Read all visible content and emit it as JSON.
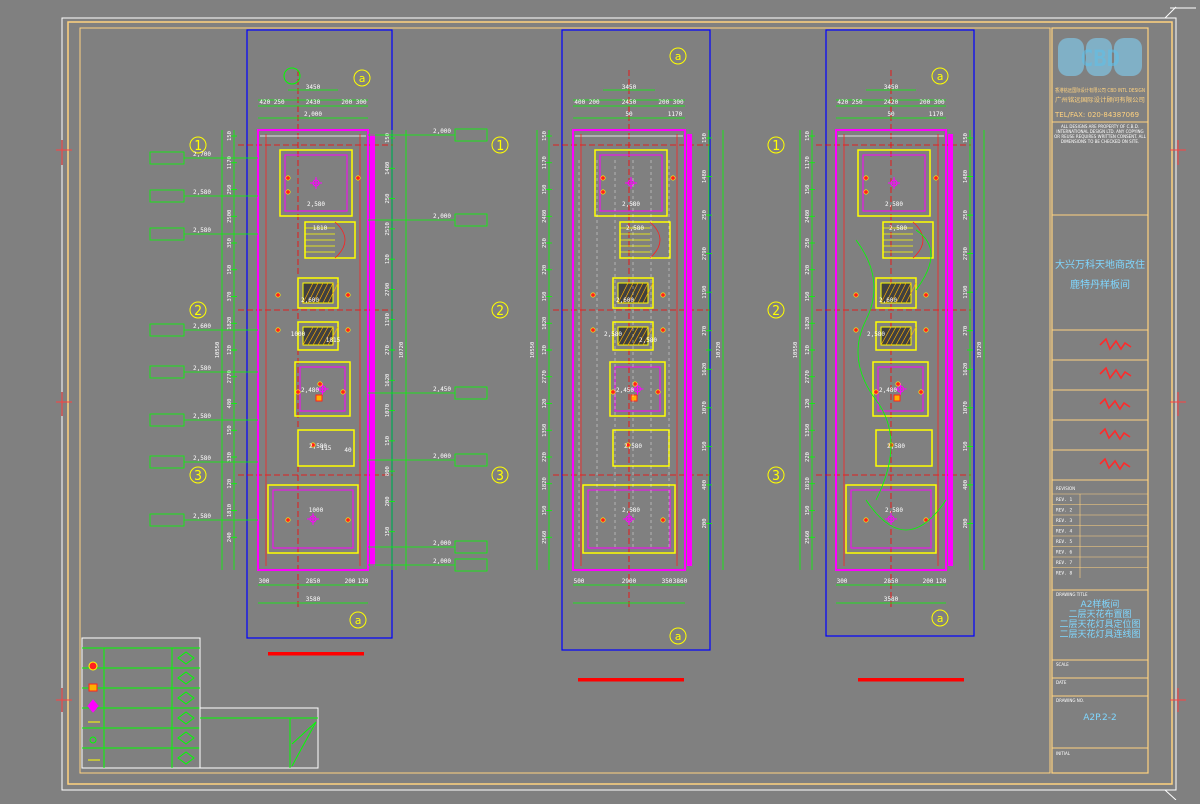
{
  "colors": {
    "background": "#808080",
    "frame": "#ffd27f",
    "wall": "#ff00ff",
    "room": "#ffff00",
    "dimension": "#00ff00",
    "text_green": "#00ff00",
    "title_blue": "#7fd7ff",
    "grid_axis": "#ff0000",
    "plan_frame": "#0000ff",
    "hatch": "#ffb000",
    "signature": "#ff2a2a"
  },
  "title_block": {
    "logo": "CBD",
    "company_line1": "香港铭远国际设计有限公司 CBD INTL DESIGN",
    "company_line2": "广州铭远国际设计顾问有限公司",
    "tel": "TEL/FAX: 020-84387069",
    "notes": "ALL DESIGNS ARE PROPERTY OF C.B.D. INTERNATIONAL DESIGN LTD. ANY COPYING OR REUSE REQUIRES WRITTEN CONSENT. ALL DIMENSIONS TO BE CHECKED ON SITE.",
    "project_line1": "大兴万科天地商改住",
    "project_line2": "鹿特丹样板间",
    "revision_header": "REVISION",
    "revisions": [
      "REV. 1",
      "REV. 2",
      "REV. 3",
      "REV. 4",
      "REV. 5",
      "REV. 6",
      "REV. 7",
      "REV. 8"
    ],
    "drawing_title_header": "DRAWING TITLE",
    "drawing_titles": [
      "A2样板间",
      "二层天花布置图",
      "二层天花灯具定位图",
      "二层天花灯具连线图"
    ],
    "scale_label": "SCALE",
    "date_label": "DATE",
    "drawing_no_label": "DRAWING NO.",
    "drawing_no": "A2P.2-2",
    "initial_label": "INITIAL"
  },
  "axes": {
    "rows": [
      "1",
      "2",
      "3"
    ],
    "col": "a"
  },
  "plans": {
    "left": {
      "top_dims": [
        "3450",
        "420 250",
        "2430",
        "200 300",
        "2,000"
      ],
      "bottom_dims": [
        "300",
        "2850",
        "200",
        "120",
        "3580"
      ],
      "room_labels": [
        "2,580",
        "1810",
        "2,600",
        "2,480",
        "2,580",
        "1000",
        "1000",
        "1815",
        "115",
        "40"
      ],
      "side_callouts": [
        "2,700",
        "2,580",
        "2,580",
        "2,600",
        "2,580",
        "2,580",
        "2,580",
        "2,580"
      ],
      "right_callouts": [
        "2,000",
        "2,000",
        "2,450",
        "2,000",
        "2,000",
        "2,000"
      ],
      "left_dims": [
        "150",
        "1170",
        "250",
        "2500",
        "350",
        "150",
        "370",
        "1820",
        "120",
        "2770",
        "480",
        "150",
        "330",
        "120",
        "1810",
        "240",
        "10550"
      ],
      "right_dims": [
        "150",
        "1480",
        "250",
        "2510",
        "120",
        "2790",
        "1190",
        "270",
        "1620",
        "1070",
        "150",
        "800",
        "200",
        "150",
        "10720"
      ]
    },
    "middle": {
      "top_dims": [
        "3450",
        "400 200",
        "2450",
        "200 300",
        "50",
        "1170"
      ],
      "bottom_dims": [
        "500",
        "2900",
        "350",
        "3860"
      ],
      "room_labels": [
        "2,580",
        "2,580",
        "2,600",
        "2,450",
        "2,580",
        "2,580",
        "2,580",
        "2,580"
      ],
      "left_dims": [
        "150",
        "1170",
        "150",
        "2480",
        "250",
        "220",
        "150",
        "1820",
        "120",
        "2770",
        "120",
        "1350",
        "220",
        "1820",
        "150",
        "2560",
        "10550"
      ],
      "right_dims": [
        "150",
        "1480",
        "250",
        "2790",
        "1190",
        "270",
        "1620",
        "1070",
        "150",
        "400",
        "200",
        "10720"
      ]
    },
    "right": {
      "top_dims": [
        "3450",
        "420 250",
        "2420",
        "200 300",
        "50",
        "1170"
      ],
      "bottom_dims": [
        "300",
        "2850",
        "200",
        "120",
        "3580"
      ],
      "room_labels": [
        "2,580",
        "2,580",
        "2,600",
        "2,480",
        "2,580",
        "2,580",
        "2,580"
      ],
      "left_dims": [
        "150",
        "1170",
        "150",
        "2480",
        "250",
        "220",
        "150",
        "1820",
        "120",
        "2770",
        "120",
        "1350",
        "220",
        "1810",
        "150",
        "2560",
        "10550"
      ],
      "right_dims": [
        "150",
        "1480",
        "250",
        "2790",
        "1190",
        "270",
        "1620",
        "1070",
        "150",
        "400",
        "200",
        "10720"
      ]
    }
  }
}
